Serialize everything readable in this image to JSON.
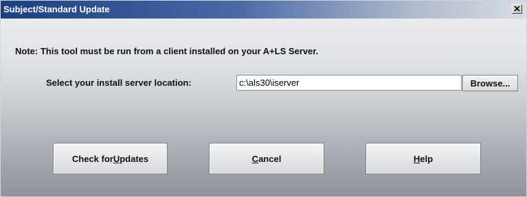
{
  "window": {
    "title": "Subject/Standard Update"
  },
  "note": "Note: This tool must be run from a client installed on your A+LS Server.",
  "server": {
    "label": "Select your install server location:",
    "path_value": "c:\\als30\\iserver",
    "browse_label": "Browse..."
  },
  "buttons": {
    "check_prefix": "Check for ",
    "check_mnemonic": "U",
    "check_suffix": "pdates",
    "cancel_mnemonic": "C",
    "cancel_suffix": "ancel",
    "help_mnemonic": "H",
    "help_suffix": "elp"
  },
  "icons": {
    "close": "close-icon"
  }
}
